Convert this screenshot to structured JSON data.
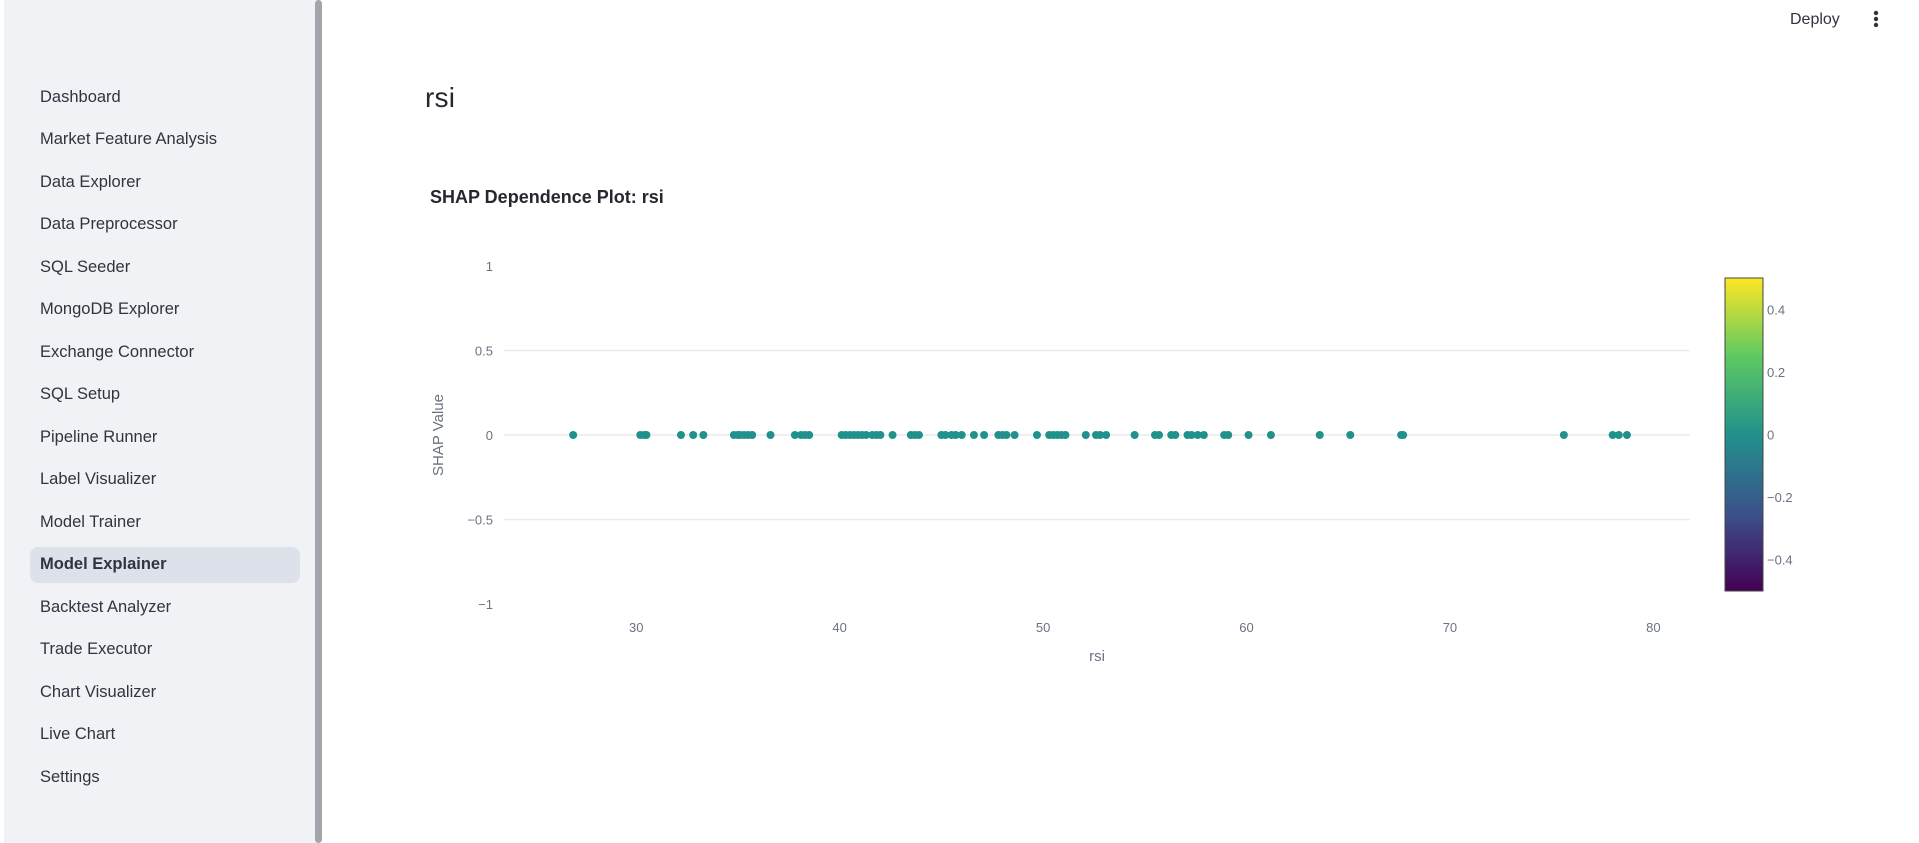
{
  "sidebar": {
    "items": [
      {
        "label": "Dashboard",
        "active": false
      },
      {
        "label": "Market Feature Analysis",
        "active": false
      },
      {
        "label": "Data Explorer",
        "active": false
      },
      {
        "label": "Data Preprocessor",
        "active": false
      },
      {
        "label": "SQL Seeder",
        "active": false
      },
      {
        "label": "MongoDB Explorer",
        "active": false
      },
      {
        "label": "Exchange Connector",
        "active": false
      },
      {
        "label": "SQL Setup",
        "active": false
      },
      {
        "label": "Pipeline Runner",
        "active": false
      },
      {
        "label": "Label Visualizer",
        "active": false
      },
      {
        "label": "Model Trainer",
        "active": false
      },
      {
        "label": "Model Explainer",
        "active": true
      },
      {
        "label": "Backtest Analyzer",
        "active": false
      },
      {
        "label": "Trade Executor",
        "active": false
      },
      {
        "label": "Chart Visualizer",
        "active": false
      },
      {
        "label": "Live Chart",
        "active": false
      },
      {
        "label": "Settings",
        "active": false
      }
    ]
  },
  "header": {
    "deploy_label": "Deploy",
    "menu_icon": "more-vertical-icon"
  },
  "main": {
    "title": "rsi"
  },
  "colors": {
    "sidebar_bg": "#f0f2f6",
    "active_item_bg": "#dde1ea",
    "marker": "#21918c",
    "grid": "#e8eaef",
    "axis_text": "#6b7280"
  },
  "chart_data": {
    "type": "scatter",
    "title": "SHAP Dependence Plot: rsi",
    "xlabel": "rsi",
    "ylabel": "SHAP Value",
    "xlim": [
      23.5,
      81.8
    ],
    "ylim": [
      -1,
      1
    ],
    "xticks": [
      30,
      40,
      50,
      60,
      70,
      80
    ],
    "yticks": [
      1,
      0.5,
      0,
      -0.5,
      -1
    ],
    "ytick_labels": [
      "1",
      "0.5",
      "0",
      "−0.5",
      "−1"
    ],
    "grid": true,
    "marker_color": "#21918c",
    "x": [
      26.9,
      30.2,
      30.4,
      30.5,
      32.2,
      32.8,
      33.3,
      34.8,
      35.0,
      35.1,
      35.3,
      35.5,
      35.7,
      36.6,
      37.8,
      38.1,
      38.3,
      38.5,
      40.1,
      40.3,
      40.5,
      40.7,
      40.9,
      41.1,
      41.3,
      41.6,
      41.8,
      42.0,
      42.6,
      43.5,
      43.7,
      43.9,
      45.0,
      45.2,
      45.5,
      45.7,
      46.0,
      46.6,
      47.1,
      47.8,
      48.0,
      48.2,
      48.6,
      49.7,
      50.3,
      50.5,
      50.7,
      50.9,
      51.1,
      52.1,
      52.6,
      52.8,
      53.1,
      54.5,
      55.5,
      55.7,
      56.3,
      56.5,
      57.1,
      57.3,
      57.6,
      57.9,
      58.9,
      59.1,
      60.1,
      61.2,
      63.6,
      65.1,
      67.6,
      67.7,
      75.6,
      78.0,
      78.3,
      78.7
    ],
    "y": [
      0,
      0,
      0,
      0,
      0,
      0,
      0,
      0,
      0,
      0,
      0,
      0,
      0,
      0,
      0,
      0,
      0,
      0,
      0,
      0,
      0,
      0,
      0,
      0,
      0,
      0,
      0,
      0,
      0,
      0,
      0,
      0,
      0,
      0,
      0,
      0,
      0,
      0,
      0,
      0,
      0,
      0,
      0,
      0,
      0,
      0,
      0,
      0,
      0,
      0,
      0,
      0,
      0,
      0,
      0,
      0,
      0,
      0,
      0,
      0,
      0,
      0,
      0,
      0,
      0,
      0,
      0,
      0,
      0,
      0,
      0,
      0,
      0,
      0
    ],
    "colorbar": {
      "range": [
        -0.5,
        0.5
      ],
      "ticks": [
        0.4,
        0.2,
        0,
        -0.2,
        -0.4
      ],
      "tick_labels": [
        "0.4",
        "0.2",
        "0",
        "−0.2",
        "−0.4"
      ],
      "colorscale": [
        "#440154",
        "#3b528b",
        "#21918c",
        "#5ec962",
        "#fde725"
      ]
    }
  }
}
